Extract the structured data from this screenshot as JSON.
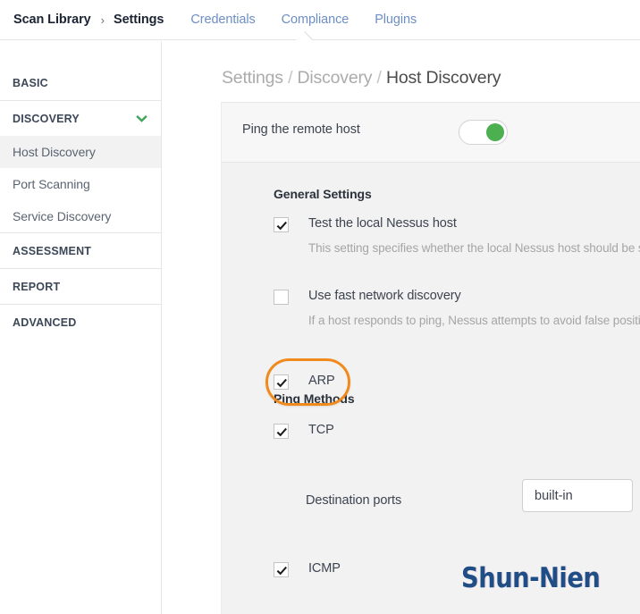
{
  "topnav": {
    "root_label": "Scan Library",
    "separator": "›",
    "tabs": [
      {
        "label": "Settings",
        "active": true
      },
      {
        "label": "Credentials",
        "active": false
      },
      {
        "label": "Compliance",
        "active": false
      },
      {
        "label": "Plugins",
        "active": false
      }
    ]
  },
  "sidebar": {
    "groups": [
      {
        "label": "BASIC",
        "expanded": false
      },
      {
        "label": "DISCOVERY",
        "expanded": true
      },
      {
        "label": "ASSESSMENT",
        "expanded": false
      },
      {
        "label": "REPORT",
        "expanded": false
      },
      {
        "label": "ADVANCED",
        "expanded": false
      }
    ],
    "discovery_items": [
      {
        "label": "Host Discovery",
        "selected": true
      },
      {
        "label": "Port Scanning",
        "selected": false
      },
      {
        "label": "Service Discovery",
        "selected": false
      }
    ],
    "chevron_icon": "chevron-down-icon",
    "chevron_color": "#3aa657"
  },
  "main": {
    "breadcrumb": {
      "part1": "Settings",
      "sep1": "/",
      "part2": "Discovery",
      "sep2": "/",
      "current": "Host Discovery"
    },
    "ping_toggle": {
      "label": "Ping the remote host",
      "state": "on",
      "knob_color": "#4caf50"
    },
    "general_settings": {
      "title": "General Settings",
      "options": [
        {
          "label": "Test the local Nessus host",
          "checked": true,
          "description": "This setting specifies whether the local Nessus host should be sc"
        },
        {
          "label": "Use fast network discovery",
          "checked": false,
          "description": "If a host responds to ping, Nessus attempts to avoid false positiv"
        }
      ]
    },
    "ping_methods": {
      "title": "Ping Methods",
      "options": [
        {
          "label": "ARP",
          "checked": true,
          "highlighted": true
        },
        {
          "label": "TCP",
          "checked": true,
          "highlighted": false
        },
        {
          "label": "ICMP",
          "checked": true,
          "highlighted": false
        }
      ],
      "destination_ports": {
        "label": "Destination ports",
        "value": "built-in",
        "placeholder": "built-in"
      }
    }
  },
  "annotation": {
    "shape": "oval",
    "color": "#f08a1c",
    "target": "ARP"
  },
  "watermark": {
    "text": "Shun-Nien",
    "color": "#1f4e87"
  }
}
